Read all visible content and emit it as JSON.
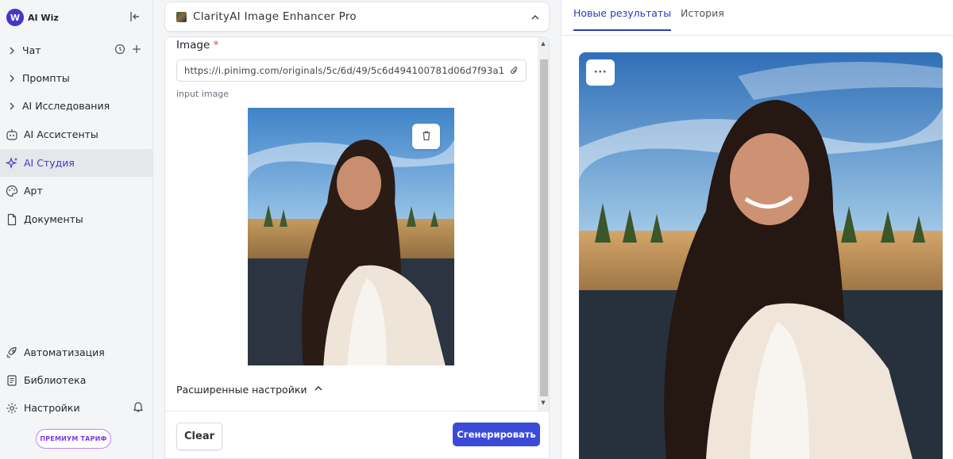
{
  "brand": {
    "logo_letter": "W",
    "name": "AI Wiz"
  },
  "sidebar": {
    "top_items": [
      {
        "label": "Чат",
        "icon": "chevron-right-icon"
      },
      {
        "label": "Промпты",
        "icon": "chevron-right-icon"
      },
      {
        "label": "AI Исследования",
        "icon": "chevron-right-icon"
      },
      {
        "label": "AI Ассистенты",
        "icon": "robot-icon"
      },
      {
        "label": "AI Студия",
        "icon": "sparkles-icon",
        "active": true
      },
      {
        "label": "Арт",
        "icon": "palette-icon"
      },
      {
        "label": "Документы",
        "icon": "document-icon"
      }
    ],
    "bottom_items": [
      {
        "label": "Автоматизация",
        "icon": "rocket-icon"
      },
      {
        "label": "Библиотека",
        "icon": "library-icon"
      },
      {
        "label": "Настройки",
        "icon": "gear-icon"
      }
    ],
    "premium_label": "ПРЕМИУМ ТАРИФ"
  },
  "model": {
    "name": "ClarityAI Image Enhancer Pro"
  },
  "form": {
    "image_label": "Image",
    "required_mark": "*",
    "image_url": "https://i.pinimg.com/originals/5c/6d/49/5c6d494100781d06d7f93a1",
    "hint": "input image",
    "advanced_label": "Расширенные настройки",
    "clear_label": "Clear",
    "generate_label": "Сгенерировать"
  },
  "results": {
    "tabs": [
      {
        "label": "Новые результаты",
        "active": true
      },
      {
        "label": "История",
        "active": false
      }
    ],
    "more_label": "···"
  },
  "colors": {
    "accent": "#3b4bd8",
    "active_nav": "#4338ca",
    "premium_border": "#c084fc",
    "required": "#e5484d"
  }
}
